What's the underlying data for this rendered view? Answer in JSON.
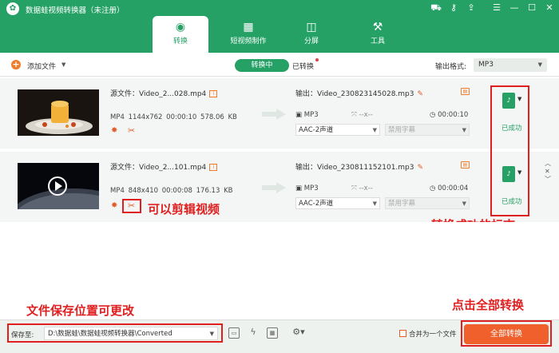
{
  "app": {
    "title": "数据蛙视频转换器（未注册）"
  },
  "window_controls": [
    "cart-icon",
    "key-icon",
    "share-icon",
    "menu-icon",
    "minimize-icon",
    "maximize-icon",
    "close-icon"
  ],
  "tabs": [
    {
      "label": "转换",
      "icon": "convert-icon",
      "active": true
    },
    {
      "label": "短视频制作",
      "icon": "film-icon",
      "active": false
    },
    {
      "label": "分屏",
      "icon": "split-screen-icon",
      "active": false
    },
    {
      "label": "工具",
      "icon": "toolbox-icon",
      "active": false
    }
  ],
  "toolbar": {
    "add_label": "添加文件",
    "converting_label": "转换中",
    "converted_label": "已转换",
    "format_label": "输出格式:",
    "format_value": "MP3"
  },
  "files": [
    {
      "source_label": "源文件：Video_2...028.mp4",
      "meta": "MP4  1144x762  00:00:10  578.06 KB",
      "output_label": "输出：Video_230823145028.mp3",
      "out_format": "MP3",
      "out_dim": "--x--",
      "out_duration": "00:00:10",
      "audio": "AAC-2声道",
      "subtitle": "禁用字幕",
      "status": "已成功",
      "format_badge": "MP3"
    },
    {
      "source_label": "源文件：Video_2...101.mp4",
      "meta": "MP4  848x410  00:00:08  176.13 KB",
      "output_label": "输出：Video_230811152101.mp3",
      "out_format": "MP3",
      "out_dim": "--x--",
      "out_duration": "00:00:04",
      "audio": "AAC-2声道",
      "subtitle": "禁用字幕",
      "status": "已成功",
      "format_badge": "MP3"
    }
  ],
  "annotations": {
    "edit_video": "可以剪辑视频",
    "success_mark": "转换成功的标志",
    "save_location": "文件保存位置可更改",
    "convert_all_hint": "点击全部转换"
  },
  "footer": {
    "save_label": "保存至:",
    "save_path": "D:\\数据蛙\\数据蛙视频转换器\\Converted",
    "merge_label": "合并为一个文件",
    "convert_all": "全部转换"
  },
  "colors": {
    "brand": "#26a166",
    "accent": "#f0602c",
    "annotation": "#e02020"
  }
}
